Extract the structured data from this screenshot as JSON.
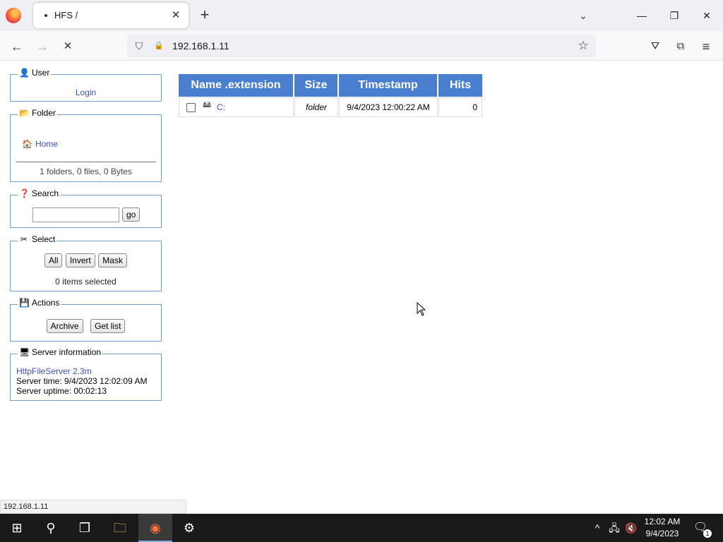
{
  "browser": {
    "tab_title": "HFS /",
    "tab_close": "✕",
    "new_tab": "+",
    "tab_list": "⌄",
    "window": {
      "minimize": "—",
      "restore": "❐",
      "close": "✕"
    },
    "nav": {
      "back": "←",
      "forward": "→",
      "reload": "✕"
    },
    "url": "192.168.1.11",
    "icons": {
      "shield": "⛉",
      "lock": "🔒",
      "bookmark": "☆",
      "pocket": "⛛",
      "extensions": "⧉",
      "menu": "≡"
    }
  },
  "sidebar": {
    "user": {
      "legend": "User",
      "icon": "👤",
      "login_link": "Login"
    },
    "folder": {
      "legend": "Folder",
      "icon": "📂",
      "home_icon": "🏠",
      "home_link": "Home",
      "summary": "1 folders, 0 files, 0 Bytes"
    },
    "search": {
      "legend": "Search",
      "icon": "❓",
      "input_value": "",
      "go_label": "go"
    },
    "select": {
      "legend": "Select",
      "icon": "✂",
      "all_label": "All",
      "invert_label": "Invert",
      "mask_label": "Mask",
      "count": "0 items selected"
    },
    "actions": {
      "legend": "Actions",
      "icon": "💾",
      "archive_label": "Archive",
      "getlist_label": "Get list"
    },
    "server": {
      "legend": "Server information",
      "icon": "🖥",
      "version_link": "HttpFileServer 2.3m",
      "time": "Server time: 9/4/2023 12:02:09 AM",
      "uptime": "Server uptime: 00:02:13"
    }
  },
  "files": {
    "columns": [
      "Name .extension",
      "Size",
      "Timestamp",
      "Hits"
    ],
    "rows": [
      {
        "name": "C:",
        "size": "folder",
        "timestamp": "9/4/2023 12:00:22 AM",
        "hits": "0"
      }
    ],
    "drive_icon": "🖴"
  },
  "status_bar": "192.168.1.11",
  "taskbar": {
    "start": "⊞",
    "search": "⚲",
    "task_view": "❐",
    "explorer": "🗀",
    "firefox": "◉",
    "settings": "⚙",
    "tray_chevron": "^",
    "tray_network": "🖧",
    "tray_volume": "🔇",
    "time": "12:02 AM",
    "date": "9/4/2023",
    "notifications": "🗨",
    "notif_count": "1"
  },
  "colors": {
    "header_blue": "#4a7fd0",
    "panel_border": "#7a9cc6",
    "link": "#3a52b8"
  }
}
